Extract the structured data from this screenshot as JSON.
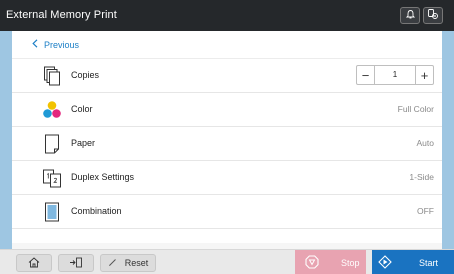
{
  "titlebar": {
    "title": "External Memory Print",
    "icons": [
      "bell-icon",
      "notification-settings-icon"
    ]
  },
  "nav": {
    "previous_label": "Previous"
  },
  "settings": [
    {
      "label": "Copies",
      "icon": "copies-icon",
      "value": "1"
    },
    {
      "label": "Color",
      "icon": "color-icon",
      "value": "Full Color"
    },
    {
      "label": "Paper",
      "icon": "paper-icon",
      "value": "Auto"
    },
    {
      "label": "Duplex Settings",
      "icon": "duplex-icon",
      "value": "1-Side"
    },
    {
      "label": "Combination",
      "icon": "combination-icon",
      "value": "OFF"
    }
  ],
  "stepper": {
    "minus": "−",
    "plus": "+"
  },
  "bottom": {
    "reset_label": "Reset",
    "stop_label": "Stop",
    "start_label": "Start"
  },
  "colors": {
    "titlebar": "#25282b",
    "accent": "#1c7fc6",
    "side_strip": "#9ec6e2",
    "stop": "#e8a3b1",
    "start": "#1a73c1"
  }
}
